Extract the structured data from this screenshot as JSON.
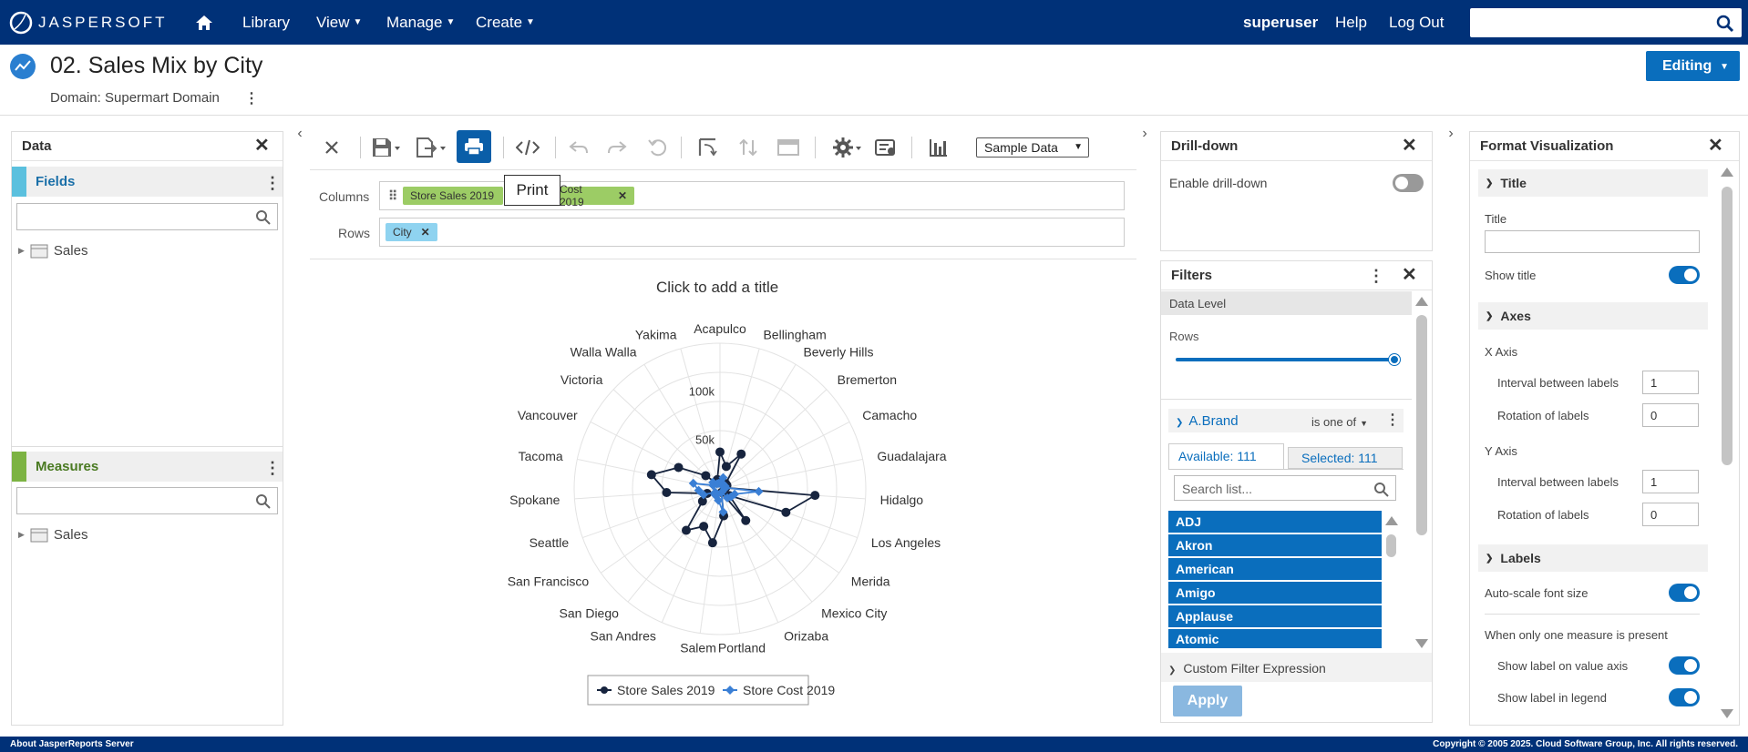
{
  "topbar": {
    "logo_text": "JASPERSOFT",
    "nav": [
      "Library",
      "View",
      "Manage",
      "Create"
    ],
    "user": "superuser",
    "help": "Help",
    "logout": "Log Out"
  },
  "header": {
    "title": "02. Sales Mix by City",
    "domain": "Domain: Supermart Domain",
    "mode_button": "Editing"
  },
  "data_panel": {
    "title": "Data",
    "fields_label": "Fields",
    "fields_tree": [
      "Sales"
    ],
    "measures_label": "Measures",
    "measures_tree": [
      "Sales"
    ]
  },
  "toolbar": {
    "data_select": "Sample Data",
    "tooltip": "Print"
  },
  "bands": {
    "columns_label": "Columns",
    "columns_pill_1": "Store Sales 2019",
    "columns_pill_2": "Cost 2019",
    "rows_label": "Rows",
    "rows_pill_1": "City"
  },
  "chart_title_placeholder": "Click to add a title",
  "chart_data": {
    "type": "radar",
    "title": "",
    "categories": [
      "Acapulco",
      "Bellingham",
      "Beverly Hills",
      "Bremerton",
      "Camacho",
      "Guadalajara",
      "Hidalgo",
      "Los Angeles",
      "Merida",
      "Mexico City",
      "Orizaba",
      "Portland",
      "Salem",
      "San Andres",
      "San Diego",
      "San Francisco",
      "Seattle",
      "Spokane",
      "Tacoma",
      "Vancouver",
      "Victoria",
      "Walla Walla",
      "Yakima"
    ],
    "radial_ticks": [
      "50k",
      "100k"
    ],
    "series": [
      {
        "name": "Store Sales 2019",
        "color": "#17243e",
        "marker": "circle",
        "values": [
          38000,
          24000,
          42000,
          8000,
          8000,
          6000,
          98000,
          72000,
          12000,
          42000,
          4000,
          28000,
          56000,
          42000,
          55000,
          22000,
          14000,
          55000,
          72000,
          48000,
          20000,
          7000,
          10000
        ]
      },
      {
        "name": "Store Cost 2019",
        "color": "#3a7fd5",
        "marker": "diamond",
        "values": [
          6000,
          12000,
          6000,
          4000,
          6000,
          6000,
          40000,
          16000,
          14000,
          12000,
          4000,
          24000,
          12000,
          6000,
          8000,
          6000,
          18000,
          22000,
          28000,
          8000,
          10000,
          6000,
          6000
        ]
      }
    ],
    "legend": "bottom"
  },
  "drilldown": {
    "title": "Drill-down",
    "enable_label": "Enable drill-down"
  },
  "filters": {
    "title": "Filters",
    "data_level": "Data Level",
    "rows_label": "Rows",
    "filter_name": "A.Brand",
    "operator": "is one of",
    "tab_available": "Available:  111",
    "tab_selected": "Selected:  111",
    "search_placeholder": "Search list...",
    "items": [
      "ADJ",
      "Akron",
      "American",
      "Amigo",
      "Applause",
      "Atomic"
    ],
    "custom_expr": "Custom Filter Expression",
    "apply": "Apply"
  },
  "format": {
    "title": "Format Visualization",
    "sec_title": "Title",
    "title_label": "Title",
    "show_title": "Show title",
    "sec_axes": "Axes",
    "x_axis": "X Axis",
    "y_axis": "Y Axis",
    "interval_label": "Interval between labels",
    "rotation_label": "Rotation of labels",
    "x_interval": "1",
    "x_rotation": "0",
    "y_interval": "1",
    "y_rotation": "0",
    "sec_labels": "Labels",
    "autoscale": "Auto-scale font size",
    "one_measure": "When only one measure is present",
    "show_value_axis": "Show label on value axis",
    "show_legend": "Show label in legend"
  },
  "footer": {
    "left": "About JasperReports Server",
    "right": "Copyright © 2005 2025. Cloud Software Group, Inc. All rights reserved."
  },
  "colors": {
    "brand_blue": "#003178",
    "accent_blue": "#0a6ebd",
    "fields_bar": "#5bc0de",
    "measures_bar": "#7cb342",
    "pill_green": "#9ccc65",
    "pill_cyan": "#8fd3f0"
  }
}
